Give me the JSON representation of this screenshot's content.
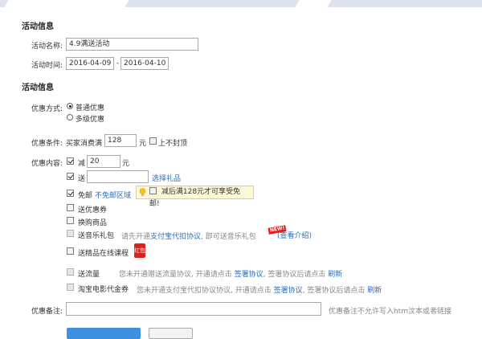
{
  "section1": {
    "title": "活动信息",
    "name_label": "活动名称:",
    "name_value": "4.9满送活动",
    "time_label": "活动时间:",
    "start_date": "2016-04-09",
    "date_sep": "-",
    "end_date": "2016-04-10"
  },
  "section2": {
    "title": "活动信息",
    "method_label": "优惠方式:",
    "method_options": [
      "普通优惠",
      "多级优惠"
    ],
    "condition_label": "优惠条件:",
    "condition_prefix": "买家消费满",
    "condition_value": "128",
    "condition_unit": "元",
    "condition_nocap": "上不封顶",
    "content_label": "优惠内容:",
    "discount_label": "减",
    "discount_value": "20",
    "discount_unit": "元",
    "gift_label": "送",
    "gift_value": "",
    "gift_link": "选择礼品",
    "freeship_label": "免邮",
    "freeship_link": "不免邮区域",
    "freeship_tip": "减后满128元才可享受免邮!",
    "coupon_label": "送优惠券",
    "exchange_label": "换购商品",
    "music_label": "送音乐礼包",
    "music_text_prefix": "请先开通",
    "music_link": "支付宝代扣协议",
    "music_text_suffix": ", 即可送音乐礼包",
    "music_badge": "NEW!",
    "music_detail": "(查看介绍)",
    "course_label": "送精品在线课程",
    "course_icon_text": "红包",
    "traffic_label": "送流量",
    "traffic_text1": "您未开通赠送流量协议, 开通请点击",
    "traffic_link1": "签署协议",
    "traffic_text2": ", 签署协议后请点击",
    "traffic_link2": "刷新",
    "movie_label": "淘宝电影代金券",
    "movie_text1": "您未开通支付宝代扣协议协议, 开通请点击",
    "movie_link1": "签署协议",
    "movie_text2": ", 签署协议后请点击",
    "movie_link2": "刷新"
  },
  "remark": {
    "label": "优惠备注:",
    "value": "",
    "hint": "优惠备注不允许写入htm汶本或者链接"
  },
  "colors": {
    "link": "#2a6ebb",
    "primary_button": "#3d8fe0",
    "tip_background": "#fff8d6"
  }
}
